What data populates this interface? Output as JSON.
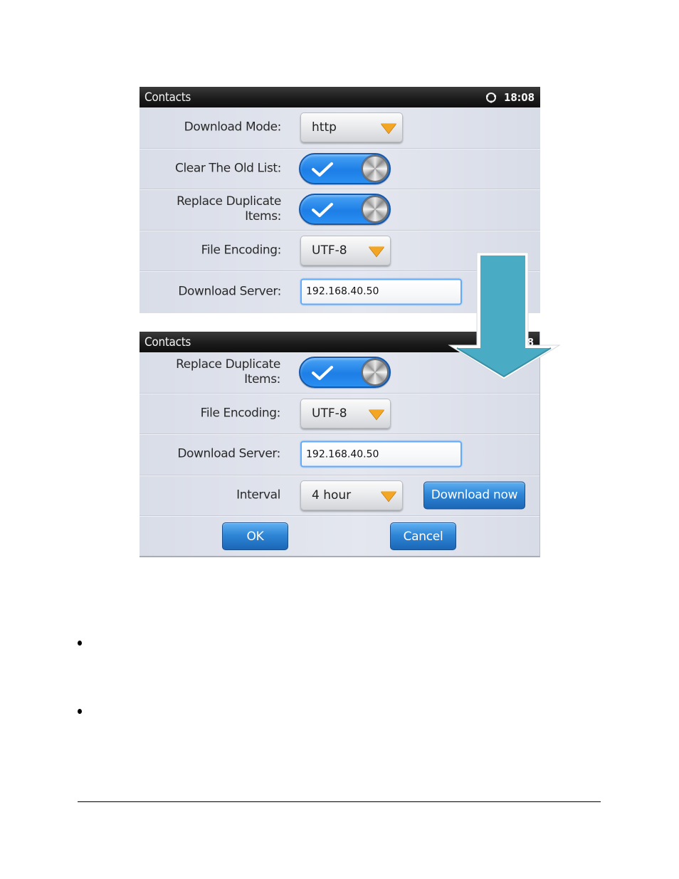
{
  "screenshots": [
    {
      "titlebar": {
        "title": "Contacts",
        "status_icon": "sync-icon",
        "time": "18:08"
      },
      "rows": [
        {
          "type": "dropdown",
          "label": "Download Mode:",
          "value": "http"
        },
        {
          "type": "toggle",
          "label": "Clear The Old List:",
          "checked": true
        },
        {
          "type": "toggle",
          "label_line1": "Replace Duplicate",
          "label_line2": "Items:",
          "checked": true
        },
        {
          "type": "dropdown",
          "label": "File Encoding:",
          "value": "UTF-8"
        },
        {
          "type": "text",
          "label": "Download Server:",
          "value": "192.168.40.50"
        }
      ]
    },
    {
      "titlebar": {
        "title": "Contacts",
        "time_partial": "8"
      },
      "rows": [
        {
          "type": "toggle",
          "label_line1": "Replace Duplicate",
          "label_line2": "Items:",
          "checked": true
        },
        {
          "type": "dropdown",
          "label": "File Encoding:",
          "value": "UTF-8"
        },
        {
          "type": "text",
          "label": "Download Server:",
          "value": "192.168.40.50"
        },
        {
          "type": "dropdown",
          "label": "Interval",
          "value": "4 hour",
          "action_button": "Download now"
        }
      ],
      "buttons": {
        "ok": "OK",
        "cancel": "Cancel"
      }
    }
  ],
  "annotation": {
    "icon": "arrow-down-icon",
    "color": "#4aabc4"
  },
  "colors": {
    "toggle_on": "#1d7ee6",
    "caret": "#f2a623",
    "field_focus": "#63aaf8",
    "button_blue": "#2f86d6"
  },
  "bullets": [
    "",
    ""
  ]
}
